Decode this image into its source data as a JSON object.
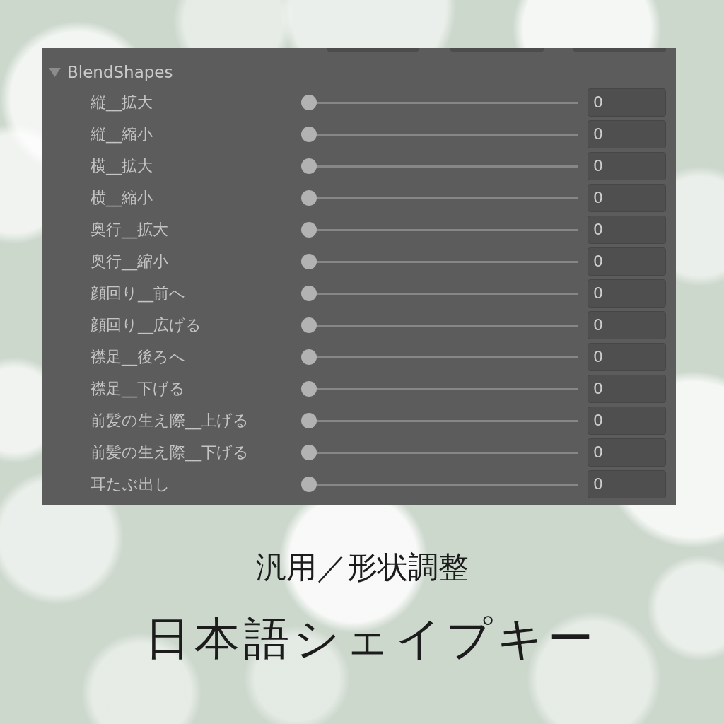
{
  "panel": {
    "title": "BlendShapes",
    "expanded": true,
    "shapes": [
      {
        "name": "縦__拡大",
        "level": 0,
        "value": "0"
      },
      {
        "name": "縦__縮小",
        "level": 0,
        "value": "0"
      },
      {
        "name": "横__拡大",
        "level": 0,
        "value": "0"
      },
      {
        "name": "横__縮小",
        "level": 0,
        "value": "0"
      },
      {
        "name": "奥行__拡大",
        "level": 0,
        "value": "0"
      },
      {
        "name": "奥行__縮小",
        "level": 0,
        "value": "0"
      },
      {
        "name": "顔回り__前へ",
        "level": 0,
        "value": "0"
      },
      {
        "name": "顔回り__広げる",
        "level": 0,
        "value": "0"
      },
      {
        "name": "襟足__後ろへ",
        "level": 0,
        "value": "0"
      },
      {
        "name": "襟足__下げる",
        "level": 0,
        "value": "0"
      },
      {
        "name": "前髪の生え際__上げる",
        "level": 0,
        "value": "0"
      },
      {
        "name": "前髪の生え際__下げる",
        "level": 0,
        "value": "0"
      },
      {
        "name": "耳たぶ出し",
        "level": 0,
        "value": "0"
      }
    ]
  },
  "caption": {
    "subtitle": "汎用／形状調整",
    "title": "日本語シェイプキー"
  }
}
